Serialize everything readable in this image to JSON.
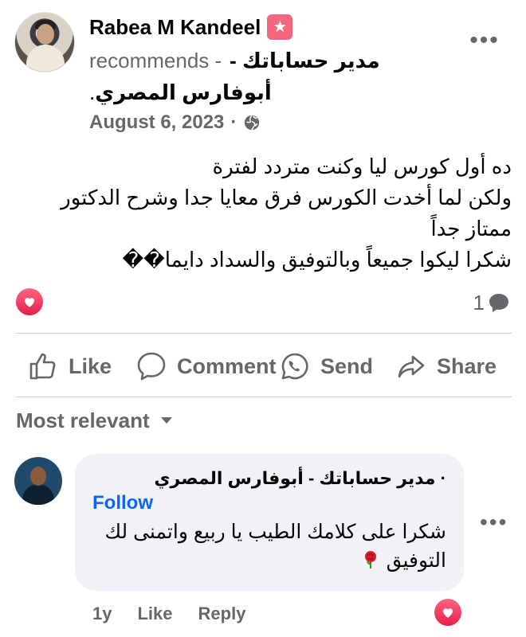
{
  "post": {
    "author": "Rabea M Kandeel",
    "action": "recommends -",
    "page_name_part1": "مدير حساباتك -",
    "page_name_part2": "أبوفارس المصري",
    "page_name_end": ".",
    "date": "August 6, 2023",
    "separator": "·",
    "text_lines": [
      "ده أول كورس ليا وكنت متردد لفترة",
      "ولكن لما أخدت الكورس فرق معايا جدا وشرح الدكتور ممتاز جداً",
      "شكرا ليكوا جميعاً وبالتوفيق والسداد دايما��"
    ],
    "comment_count": "1",
    "icons": {
      "badge": "star-badge-icon",
      "audience": "globe-icon",
      "reaction": "heart-reaction-icon",
      "comment_count": "comment-bubble-icon"
    }
  },
  "actions": {
    "like": "Like",
    "comment": "Comment",
    "send": "Send",
    "share": "Share"
  },
  "sort": {
    "label": "Most relevant"
  },
  "comment": {
    "author": "مدير حساباتك - أبوفارس المصري",
    "author_prefix": "·",
    "follow": "Follow",
    "text": "شكرا على كلامك الطيب يا ربيع واتمنى لك التوفيق",
    "emoji": "rose-icon",
    "time": "1y",
    "like": "Like",
    "reply": "Reply"
  },
  "colors": {
    "badge": "#f5677f",
    "heart": "#e61e4d",
    "link_blue": "#0866ff",
    "secondary_text": "#65676b",
    "bubble_bg": "#f0f2f5"
  }
}
